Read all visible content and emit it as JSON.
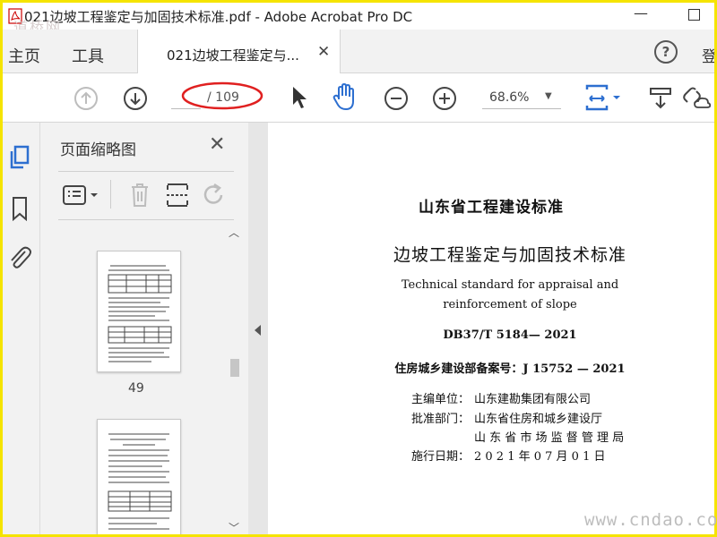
{
  "window": {
    "title": "021边坡工程鉴定与加固技术标准.pdf - Adobe Acrobat Pro DC",
    "watermark_top": "道桥网"
  },
  "nav": {
    "home": "主页",
    "tools": "工具"
  },
  "tab": {
    "label": "021边坡工程鉴定与..."
  },
  "help": "?",
  "signin": "登",
  "toolbar": {
    "current_page": "",
    "total_pages": "/ 109",
    "zoom": "68.6%"
  },
  "colors": {
    "accent_blue": "#2d6fd0",
    "annotation_red": "#e02020",
    "watermark_yellow": "#f5e400"
  },
  "thumbnails": {
    "title": "页面缩略图",
    "pages": [
      {
        "label": "49"
      },
      {
        "label": ""
      }
    ]
  },
  "document": {
    "standard": "山东省工程建设标准",
    "title_cn": "边坡工程鉴定与加固技术标准",
    "title_en_1": "Technical standard for appraisal and",
    "title_en_2": "reinforcement of slope",
    "code": "DB37/T 5184— 2021",
    "record": "住房城乡建设部备案号：J 15752 — 2021",
    "meta": [
      {
        "label": "主编单位：",
        "value": "山东建勘集团有限公司"
      },
      {
        "label": "批准部门：",
        "value": "山东省住房和城乡建设厅"
      },
      {
        "label": "",
        "value": "山 东 省 市 场 监 督 管 理 局"
      },
      {
        "label": "施行日期：",
        "value": "2 0 2 1 年 0 7 月 0 1 日"
      }
    ]
  },
  "watermark_bottom": "www.cndao.com"
}
